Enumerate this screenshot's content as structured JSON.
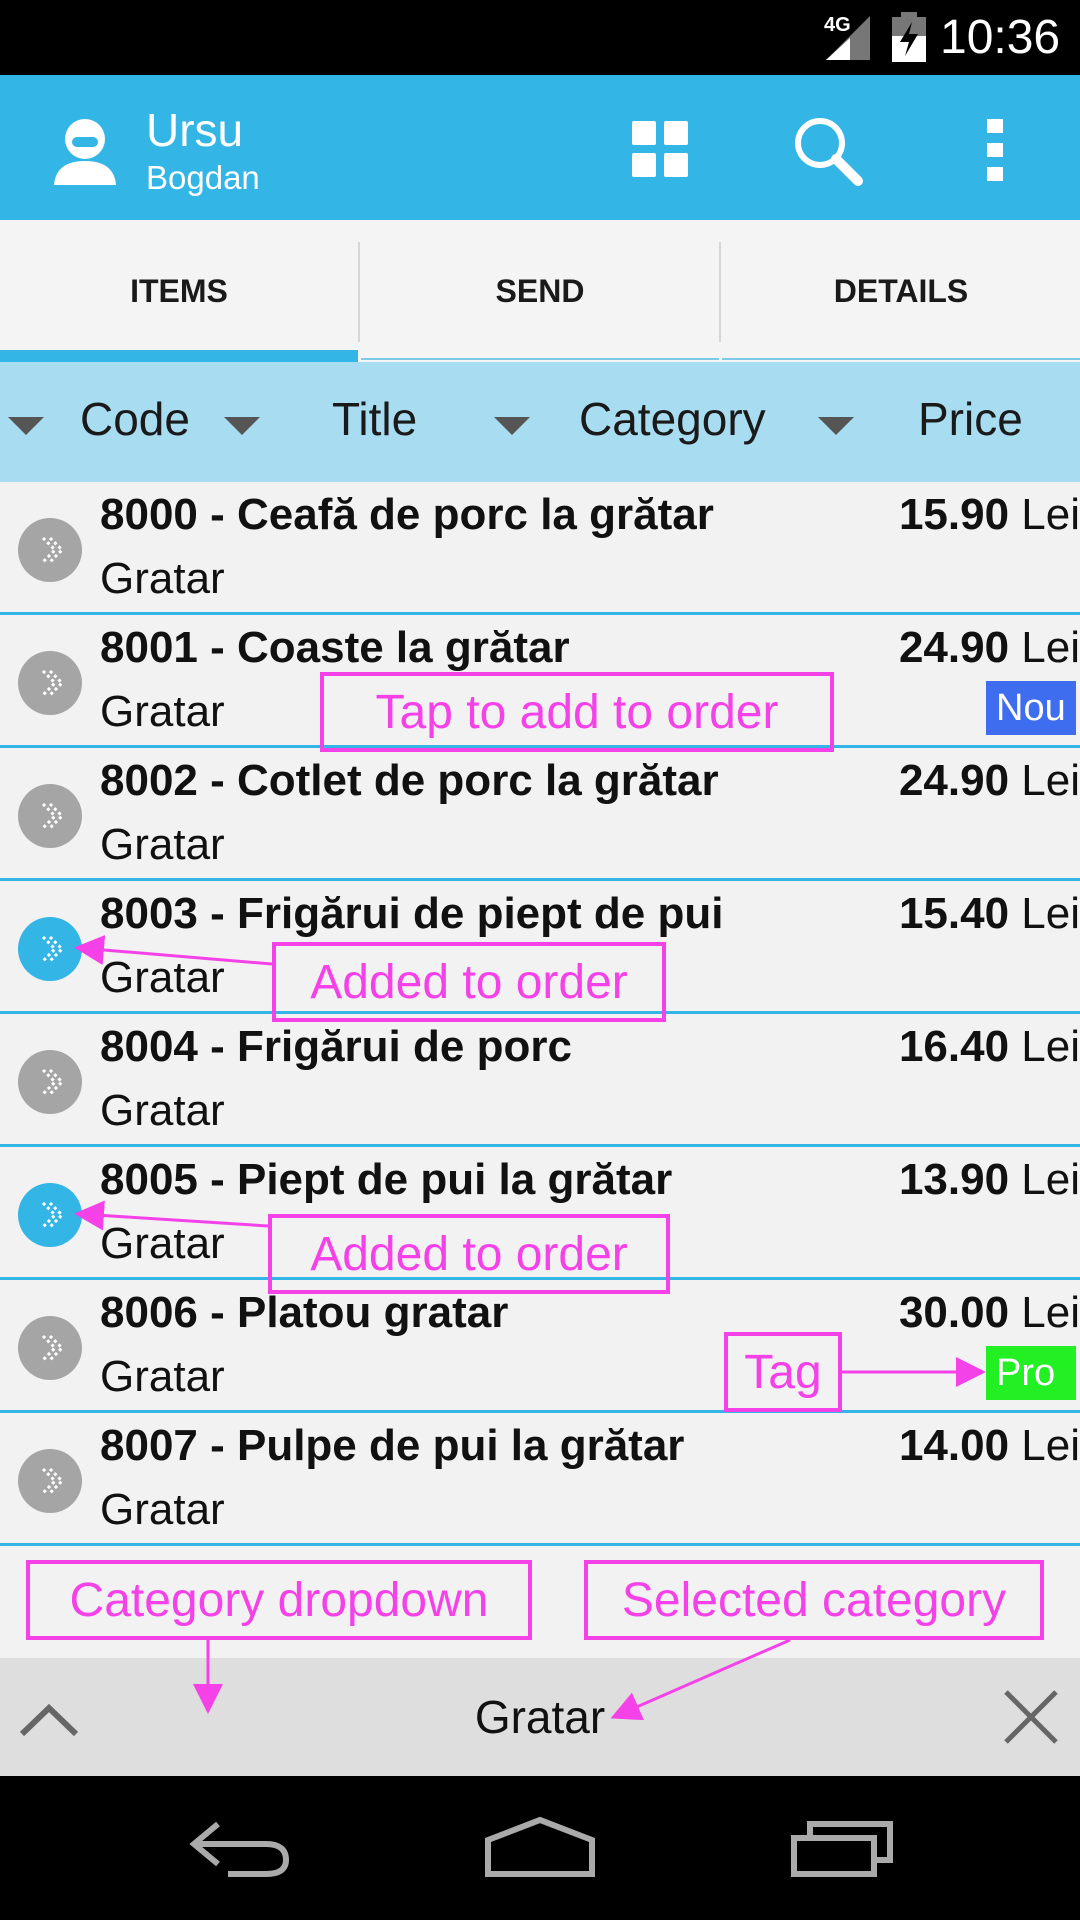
{
  "status_bar": {
    "network_label": "4G",
    "time": "10:36"
  },
  "action_bar": {
    "user_last_name": "Ursu",
    "user_first_name": "Bogdan",
    "icons": [
      "user-icon",
      "grid-icon",
      "search-icon",
      "overflow-menu-icon"
    ]
  },
  "tabs": [
    {
      "label": "ITEMS",
      "selected": true
    },
    {
      "label": "SEND",
      "selected": false
    },
    {
      "label": "DETAILS",
      "selected": false
    }
  ],
  "columns": [
    "Code",
    "Title",
    "Category",
    "Price"
  ],
  "items": [
    {
      "title": "8000 - Ceafă de porc la grătar",
      "category": "Gratar",
      "price": "15.90",
      "currency": "Lei",
      "added": false,
      "tag": ""
    },
    {
      "title": "8001 - Coaste la grătar",
      "category": "Gratar",
      "price": "24.90",
      "currency": "Lei",
      "added": false,
      "tag": "Nou"
    },
    {
      "title": "8002 - Cotlet de porc la grătar",
      "category": "Gratar",
      "price": "24.90",
      "currency": "Lei",
      "added": false,
      "tag": ""
    },
    {
      "title": "8003 - Frigărui de piept de pui",
      "category": "Gratar",
      "price": "15.40",
      "currency": "Lei",
      "added": true,
      "tag": ""
    },
    {
      "title": "8004 - Frigărui de porc",
      "category": "Gratar",
      "price": "16.40",
      "currency": "Lei",
      "added": false,
      "tag": ""
    },
    {
      "title": "8005 - Piept de pui la grătar",
      "category": "Gratar",
      "price": "13.90",
      "currency": "Lei",
      "added": true,
      "tag": ""
    },
    {
      "title": "8006 - Platou gratar",
      "category": "Gratar",
      "price": "30.00",
      "currency": "Lei",
      "added": false,
      "tag": "Pro"
    },
    {
      "title": "8007 - Pulpe de pui la grătar",
      "category": "Gratar",
      "price": "14.00",
      "currency": "Lei",
      "added": false,
      "tag": ""
    }
  ],
  "annotations": {
    "tap_to_add": "Tap to add to order",
    "added_1": "Added to order",
    "added_2": "Added to order",
    "tag": "Tag",
    "category_dropdown": "Category dropdown",
    "selected_category": "Selected category"
  },
  "filter_bar": {
    "selected_category": "Gratar"
  },
  "colors": {
    "accent": "#33b5e5",
    "annotation": "#f442e8",
    "tag_nou": "#3f6df0",
    "tag_pro": "#22f022"
  }
}
